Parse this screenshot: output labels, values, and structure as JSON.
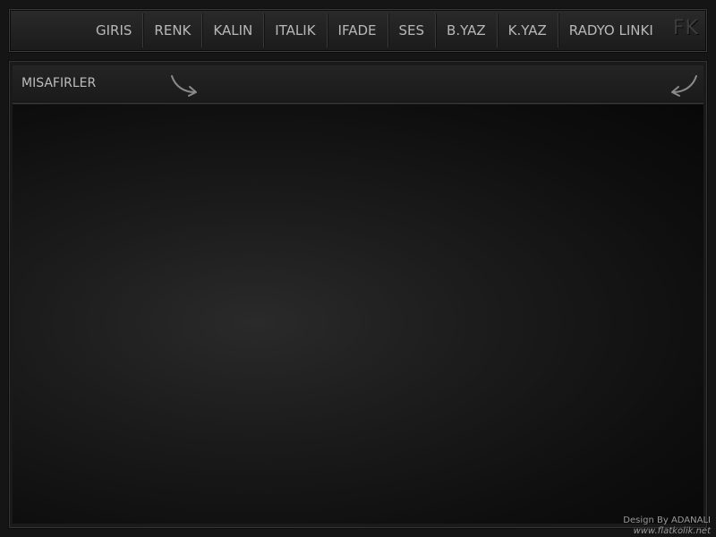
{
  "nav": {
    "items": [
      {
        "label": "GIRIS"
      },
      {
        "label": "RENK"
      },
      {
        "label": "KALIN"
      },
      {
        "label": "ITALIK"
      },
      {
        "label": "IFADE"
      },
      {
        "label": "SES"
      },
      {
        "label": "B.YAZ"
      },
      {
        "label": "K.YAZ"
      },
      {
        "label": "RADYO LINKI"
      }
    ],
    "logo": "FK"
  },
  "panel": {
    "title": "MISAFIRLER",
    "left_icon": "curved-arrow-icon",
    "right_icon": "curved-arrow-icon"
  },
  "footer": {
    "credit": "Design By ADANALI",
    "url": "www.flatkolik.net"
  }
}
